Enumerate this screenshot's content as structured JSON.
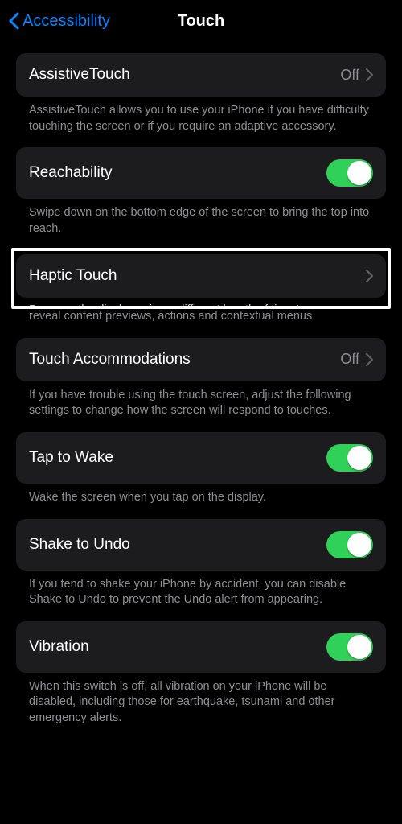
{
  "nav": {
    "back": "Accessibility",
    "title": "Touch"
  },
  "items": {
    "assistive": {
      "label": "AssistiveTouch",
      "value": "Off",
      "footer": "AssistiveTouch allows you to use your iPhone if you have difficulty touching the screen or if you require an adaptive accessory."
    },
    "reachability": {
      "label": "Reachability",
      "on": true,
      "footer": "Swipe down on the bottom edge of the screen to bring the top into reach."
    },
    "haptic": {
      "label": "Haptic Touch",
      "footer_clipped": "Press on the display using a different length of time to",
      "footer_rest": "reveal content previews, actions and contextual menus."
    },
    "accommodations": {
      "label": "Touch Accommodations",
      "value": "Off",
      "footer": "If you have trouble using the touch screen, adjust the following settings to change how the screen will respond to touches."
    },
    "tapwake": {
      "label": "Tap to Wake",
      "on": true,
      "footer": "Wake the screen when you tap on the display."
    },
    "shake": {
      "label": "Shake to Undo",
      "on": true,
      "footer": "If you tend to shake your iPhone by accident, you can disable Shake to Undo to prevent the Undo alert from appearing."
    },
    "vibration": {
      "label": "Vibration",
      "on": true,
      "footer": "When this switch is off, all vibration on your iPhone will be disabled, including those for earthquake, tsunami and other emergency alerts."
    }
  }
}
